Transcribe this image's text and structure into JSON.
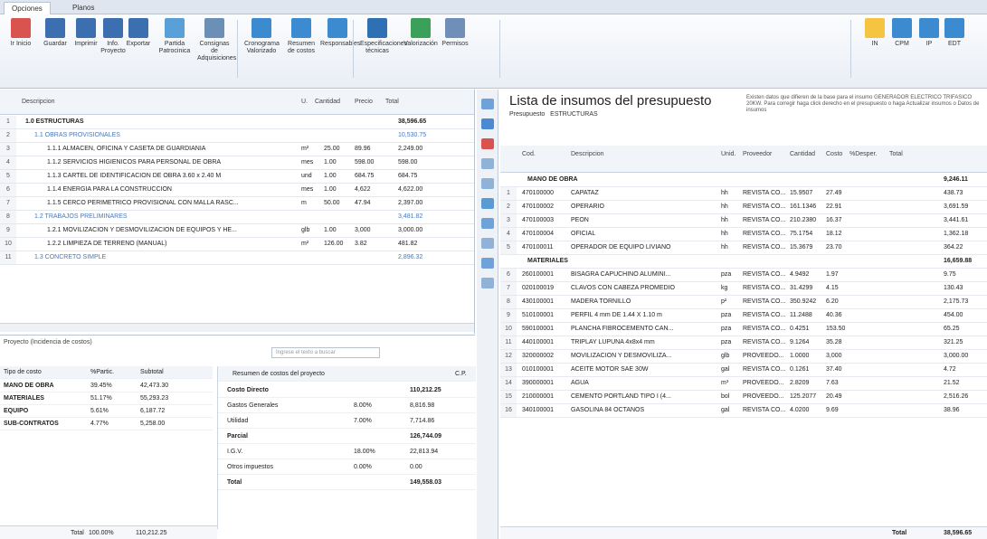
{
  "tabs": [
    "Opciones",
    "Planos"
  ],
  "ribbon": [
    "Ir Inicio",
    "Guardar",
    "Imprimir",
    "Info. Proyecto",
    "Exportar",
    "Partida Patrocinica",
    "Consignas de Adquisiciones",
    "Cronograma Valorizado",
    "Resumen de costos",
    "Responsables",
    "Especificaciones técnicas",
    "Valorización",
    "Permisos",
    "IN",
    "CPM",
    "IP",
    "EDT"
  ],
  "left_grid": {
    "headers": [
      "Descripcion",
      "U.",
      "Cantidad",
      "Precio",
      "Total"
    ],
    "rows": [
      {
        "n": "1",
        "desc": "1.0  ESTRUCTURAS",
        "u": "",
        "cant": "",
        "precio": "",
        "total": "38,596.65",
        "kind": "grp"
      },
      {
        "n": "2",
        "desc": "1.1  OBRAS PROVISIONALES",
        "u": "",
        "cant": "",
        "precio": "",
        "total": "10,530.75",
        "kind": "sub"
      },
      {
        "n": "3",
        "desc": "1.1.1  ALMACEN, OFICINA Y CASETA DE GUARDIANIA",
        "u": "m²",
        "cant": "25.00",
        "precio": "89.96",
        "total": "2,249.00",
        "kind": "item"
      },
      {
        "n": "4",
        "desc": "1.1.2  SERVICIOS HIGIENICOS PARA PERSONAL DE OBRA",
        "u": "mes",
        "cant": "1.00",
        "precio": "598.00",
        "total": "598.00",
        "kind": "item"
      },
      {
        "n": "5",
        "desc": "1.1.3  CARTEL DE IDENTIFICACION DE OBRA 3.60 x 2.40 M",
        "u": "und",
        "cant": "1.00",
        "precio": "684.75",
        "total": "684.75",
        "kind": "item"
      },
      {
        "n": "6",
        "desc": "1.1.4  ENERGIA PARA LA CONSTRUCCION",
        "u": "mes",
        "cant": "1.00",
        "precio": "4,622",
        "total": "4,622.00",
        "kind": "item"
      },
      {
        "n": "7",
        "desc": "1.1.5  CERCO PERIMETRICO PROVISIONAL CON MALLA RASC...",
        "u": "m",
        "cant": "50.00",
        "precio": "47.94",
        "total": "2,397.00",
        "kind": "item"
      },
      {
        "n": "8",
        "desc": "1.2  TRABAJOS PRELIMINARES",
        "u": "",
        "cant": "",
        "precio": "",
        "total": "3,481.82",
        "kind": "sub"
      },
      {
        "n": "9",
        "desc": "1.2.1  MOVILIZACION Y DESMOVILIZACION DE EQUIPOS Y HE...",
        "u": "glb",
        "cant": "1.00",
        "precio": "3,000",
        "total": "3,000.00",
        "kind": "item"
      },
      {
        "n": "10",
        "desc": "1.2.2  LIMPIEZA DE TERRENO (MANUAL)",
        "u": "m²",
        "cant": "126.00",
        "precio": "3.82",
        "total": "481.82",
        "kind": "item"
      },
      {
        "n": "11",
        "desc": "1.3  CONCRETO SIMPLE",
        "u": "",
        "cant": "",
        "precio": "",
        "total": "2,896.32",
        "kind": "sub"
      }
    ]
  },
  "bottom_left": {
    "title": "Proyecto (Incidencia de costos)",
    "search_placeholder": "Ingrese el texto a buscar",
    "headers": [
      "Tipo de costo",
      "%Partic.",
      "Subtotal"
    ],
    "rows": [
      {
        "tipo": "MANO DE OBRA",
        "pct": "39.45%",
        "sub": "42,473.30"
      },
      {
        "tipo": "MATERIALES",
        "pct": "51.17%",
        "sub": "55,293.23"
      },
      {
        "tipo": "EQUIPO",
        "pct": "5.61%",
        "sub": "6,187.72"
      },
      {
        "tipo": "SUB-CONTRATOS",
        "pct": "4.77%",
        "sub": "5,258.00"
      }
    ],
    "total_label": "Total",
    "total_pct": "100.00%",
    "total_sub": "110,212.25"
  },
  "resumen": {
    "title": "Resumen de costos del proyecto",
    "code": "C.P.",
    "rows": [
      {
        "label": "Costo Directo",
        "pct": "",
        "val": "110,212.25",
        "bold": true
      },
      {
        "label": "Gastos Generales",
        "pct": "8.00%",
        "val": "8,816.98",
        "bold": false
      },
      {
        "label": "Utilidad",
        "pct": "7.00%",
        "val": "7,714.86",
        "bold": false
      },
      {
        "label": "Parcial",
        "pct": "",
        "val": "126,744.09",
        "bold": true
      },
      {
        "label": "I.G.V.",
        "pct": "18.00%",
        "val": "22,813.94",
        "bold": false
      },
      {
        "label": "Otros impuestos",
        "pct": "0.00%",
        "val": "0.00",
        "bold": false
      },
      {
        "label": "Total",
        "pct": "",
        "val": "149,558.03",
        "bold": true
      }
    ]
  },
  "right": {
    "title": "Lista de insumos del presupuesto",
    "presupuesto_label": "Presupuesto",
    "presupuesto_value": "ESTRUCTURAS",
    "warning": "Existen datos que difieren de la base para el insumo GENERADOR ELECTRICO TRIFASICO 20KW. Para corregir haga click derecho en el presupuesto o haga Actualizar insumos o Datos de insumos",
    "headers": [
      "Cod.",
      "Descripcion",
      "Unid.",
      "Proveedor",
      "Cantidad",
      "Costo",
      "%Desper.",
      "Total"
    ],
    "groups": [
      {
        "name": "MANO DE OBRA",
        "total": "9,246.11",
        "rows": [
          {
            "n": "1",
            "cod": "470100000",
            "desc": "CAPATAZ",
            "u": "hh",
            "prov": "REVISTA CO...",
            "cant": "15.9507",
            "costo": "27.49",
            "total": "438.73"
          },
          {
            "n": "2",
            "cod": "470100002",
            "desc": "OPERARIO",
            "u": "hh",
            "prov": "REVISTA CO...",
            "cant": "161.1346",
            "costo": "22.91",
            "total": "3,691.59"
          },
          {
            "n": "3",
            "cod": "470100003",
            "desc": "PEON",
            "u": "hh",
            "prov": "REVISTA CO...",
            "cant": "210.2380",
            "costo": "16.37",
            "total": "3,441.61"
          },
          {
            "n": "4",
            "cod": "470100004",
            "desc": "OFICIAL",
            "u": "hh",
            "prov": "REVISTA CO...",
            "cant": "75.1754",
            "costo": "18.12",
            "total": "1,362.18"
          },
          {
            "n": "5",
            "cod": "470100011",
            "desc": "OPERADOR DE EQUIPO LIVIANO",
            "u": "hh",
            "prov": "REVISTA CO...",
            "cant": "15.3679",
            "costo": "23.70",
            "total": "364.22"
          }
        ]
      },
      {
        "name": "MATERIALES",
        "total": "16,659.88",
        "rows": [
          {
            "n": "6",
            "cod": "260100001",
            "desc": "BISAGRA CAPUCHINO ALUMINI...",
            "u": "pza",
            "prov": "REVISTA CO...",
            "cant": "4.9492",
            "costo": "1.97",
            "total": "9.75"
          },
          {
            "n": "7",
            "cod": "020100019",
            "desc": "CLAVOS CON CABEZA PROMEDIO",
            "u": "kg",
            "prov": "REVISTA CO...",
            "cant": "31.4299",
            "costo": "4.15",
            "total": "130.43"
          },
          {
            "n": "8",
            "cod": "430100001",
            "desc": "MADERA TORNILLO",
            "u": "p²",
            "prov": "REVISTA CO...",
            "cant": "350.9242",
            "costo": "6.20",
            "total": "2,175.73"
          },
          {
            "n": "9",
            "cod": "510100001",
            "desc": "PERFIL 4 mm DE 1.44 X 1.10 m",
            "u": "pza",
            "prov": "REVISTA CO...",
            "cant": "11.2488",
            "costo": "40.36",
            "total": "454.00"
          },
          {
            "n": "10",
            "cod": "590100001",
            "desc": "PLANCHA FIBROCEMENTO CAN...",
            "u": "pza",
            "prov": "REVISTA CO...",
            "cant": "0.4251",
            "costo": "153.50",
            "total": "65.25"
          },
          {
            "n": "11",
            "cod": "440100001",
            "desc": "TRIPLAY LUPUNA 4x8x4 mm",
            "u": "pza",
            "prov": "REVISTA CO...",
            "cant": "9.1264",
            "costo": "35.28",
            "total": "321.25"
          },
          {
            "n": "12",
            "cod": "320000002",
            "desc": "MOVILIZACION Y DESMOVILIZA...",
            "u": "glb",
            "prov": "PROVEEDO...",
            "cant": "1.0000",
            "costo": "3,000",
            "total": "3,000.00"
          },
          {
            "n": "13",
            "cod": "010100001",
            "desc": "ACEITE MOTOR SAE 30W",
            "u": "gal",
            "prov": "REVISTA CO...",
            "cant": "0.1261",
            "costo": "37.40",
            "total": "4.72"
          },
          {
            "n": "14",
            "cod": "390000001",
            "desc": "AGUA",
            "u": "m³",
            "prov": "PROVEEDO...",
            "cant": "2.8209",
            "costo": "7.63",
            "total": "21.52"
          },
          {
            "n": "15",
            "cod": "210000001",
            "desc": "CEMENTO PORTLAND TIPO I (4...",
            "u": "bol",
            "prov": "PROVEEDO...",
            "cant": "125.2077",
            "costo": "20.49",
            "total": "2,516.26"
          },
          {
            "n": "16",
            "cod": "340100001",
            "desc": "GASOLINA 84 OCTANOS",
            "u": "gal",
            "prov": "REVISTA CO...",
            "cant": "4.0200",
            "costo": "9.69",
            "total": "38.96"
          }
        ]
      }
    ],
    "footer_label": "Total",
    "footer_total": "38,596.65"
  }
}
